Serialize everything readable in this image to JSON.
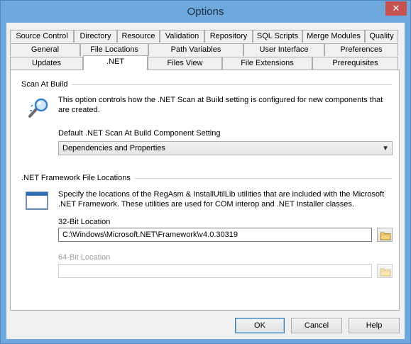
{
  "window": {
    "title": "Options",
    "close_glyph": "✕"
  },
  "tabs_row1": [
    "Source Control",
    "Directory",
    "Resource",
    "Validation",
    "Repository",
    "SQL Scripts",
    "Merge Modules",
    "Quality"
  ],
  "tabs_row2": [
    "General",
    "File Locations",
    "Path Variables",
    "User Interface",
    "Preferences"
  ],
  "tabs_row3": [
    "Updates",
    ".NET",
    "Files View",
    "File Extensions",
    "Prerequisites"
  ],
  "active_tab": ".NET",
  "scan": {
    "group_title": "Scan At Build",
    "description": "This option controls how the .NET Scan at Build setting is configured for new components that are created.",
    "setting_label": "Default .NET Scan At Build Component Setting",
    "setting_value": "Dependencies and Properties"
  },
  "framework": {
    "group_title": ".NET Framework File Locations",
    "description": "Specify the locations of the RegAsm & InstallUtilLib utilities that are included with the Microsoft .NET Framework.  These utilities are used for COM interop and .NET Installer classes.",
    "bit32_label": "32-Bit Location",
    "bit32_value": "C:\\Windows\\Microsoft.NET\\Framework\\v4.0.30319",
    "bit64_label": "64-Bit Location",
    "bit64_value": ""
  },
  "buttons": {
    "ok": "OK",
    "cancel": "Cancel",
    "help": "Help"
  },
  "icons": [
    "magnifier-icon",
    "window-icon",
    "folder-icon"
  ]
}
